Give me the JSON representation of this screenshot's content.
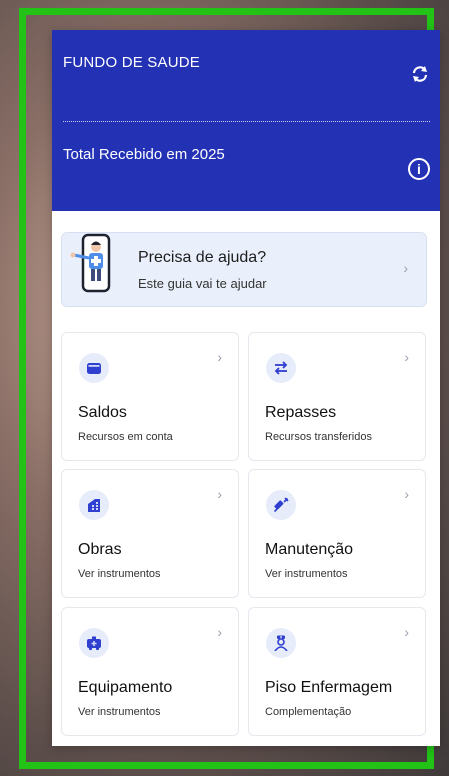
{
  "header": {
    "title": "FUNDO DE SAUDE",
    "total_label": "Total Recebido em 2025",
    "info_glyph": "i",
    "refresh_icon": "refresh-icon",
    "color": "#2331b5"
  },
  "help": {
    "title": "Precisa de ajuda?",
    "subtitle": "Este guia vai te ajudar",
    "chevron": "›"
  },
  "cards": [
    {
      "label": "Saldos",
      "sub": "Recursos em conta",
      "icon": "wallet-icon",
      "chevron": "›"
    },
    {
      "label": "Repasses",
      "sub": "Recursos transferidos",
      "icon": "transfer-icon",
      "chevron": "›"
    },
    {
      "label": "Obras",
      "sub": "Ver instrumentos",
      "icon": "building-icon",
      "chevron": "›"
    },
    {
      "label": "Manutenção",
      "sub": "Ver instrumentos",
      "icon": "syringe-icon",
      "chevron": "›"
    },
    {
      "label": "Equipamento",
      "sub": "Ver instrumentos",
      "icon": "ambulance-icon",
      "chevron": "›"
    },
    {
      "label": "Piso Enfermagem",
      "sub": "Complementação",
      "icon": "nurse-icon",
      "chevron": "›"
    }
  ],
  "accent": "#2f3fcf",
  "frame_color": "#22c316"
}
